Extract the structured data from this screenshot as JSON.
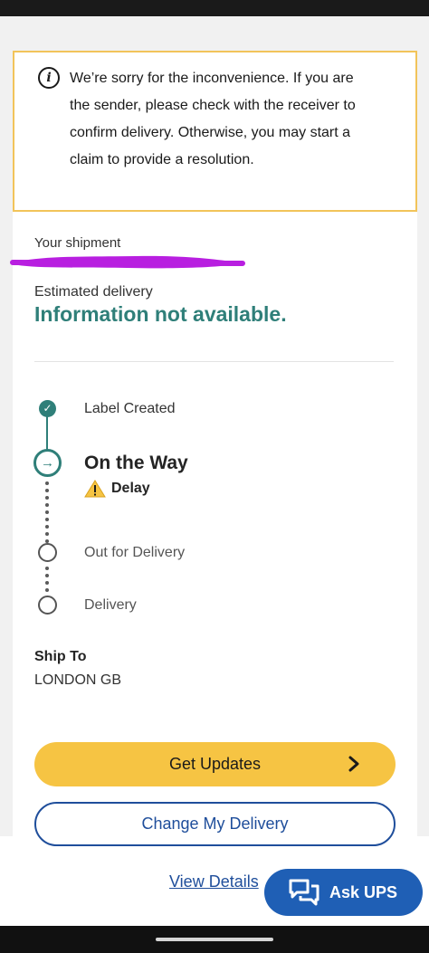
{
  "alert": {
    "message": "We’re sorry for the inconvenience. If you are the sender, please check with the receiver to confirm delivery. Otherwise, you may start a claim to provide a resolution.",
    "icon": "info-icon"
  },
  "shipment": {
    "label": "Your shipment"
  },
  "estimated": {
    "label": "Estimated delivery",
    "value": "Information not available."
  },
  "timeline": {
    "steps": [
      {
        "label": "Label Created",
        "state": "done"
      },
      {
        "label": "On the Way",
        "state": "current"
      },
      {
        "label": "Out for Delivery",
        "state": "pending"
      },
      {
        "label": "Delivery",
        "state": "pending"
      }
    ],
    "status_note": "Delay"
  },
  "ship_to": {
    "label": "Ship To",
    "value": "LONDON GB"
  },
  "actions": {
    "get_updates": "Get Updates",
    "change_delivery": "Change My Delivery",
    "view_details": "View Details",
    "ask_ups": "Ask UPS"
  },
  "colors": {
    "accent_teal": "#2f7f79",
    "ups_gold": "#f6c443",
    "ups_blue": "#1f5fb5",
    "alert_border": "#f2c45a",
    "redaction": "#b81fe0"
  }
}
